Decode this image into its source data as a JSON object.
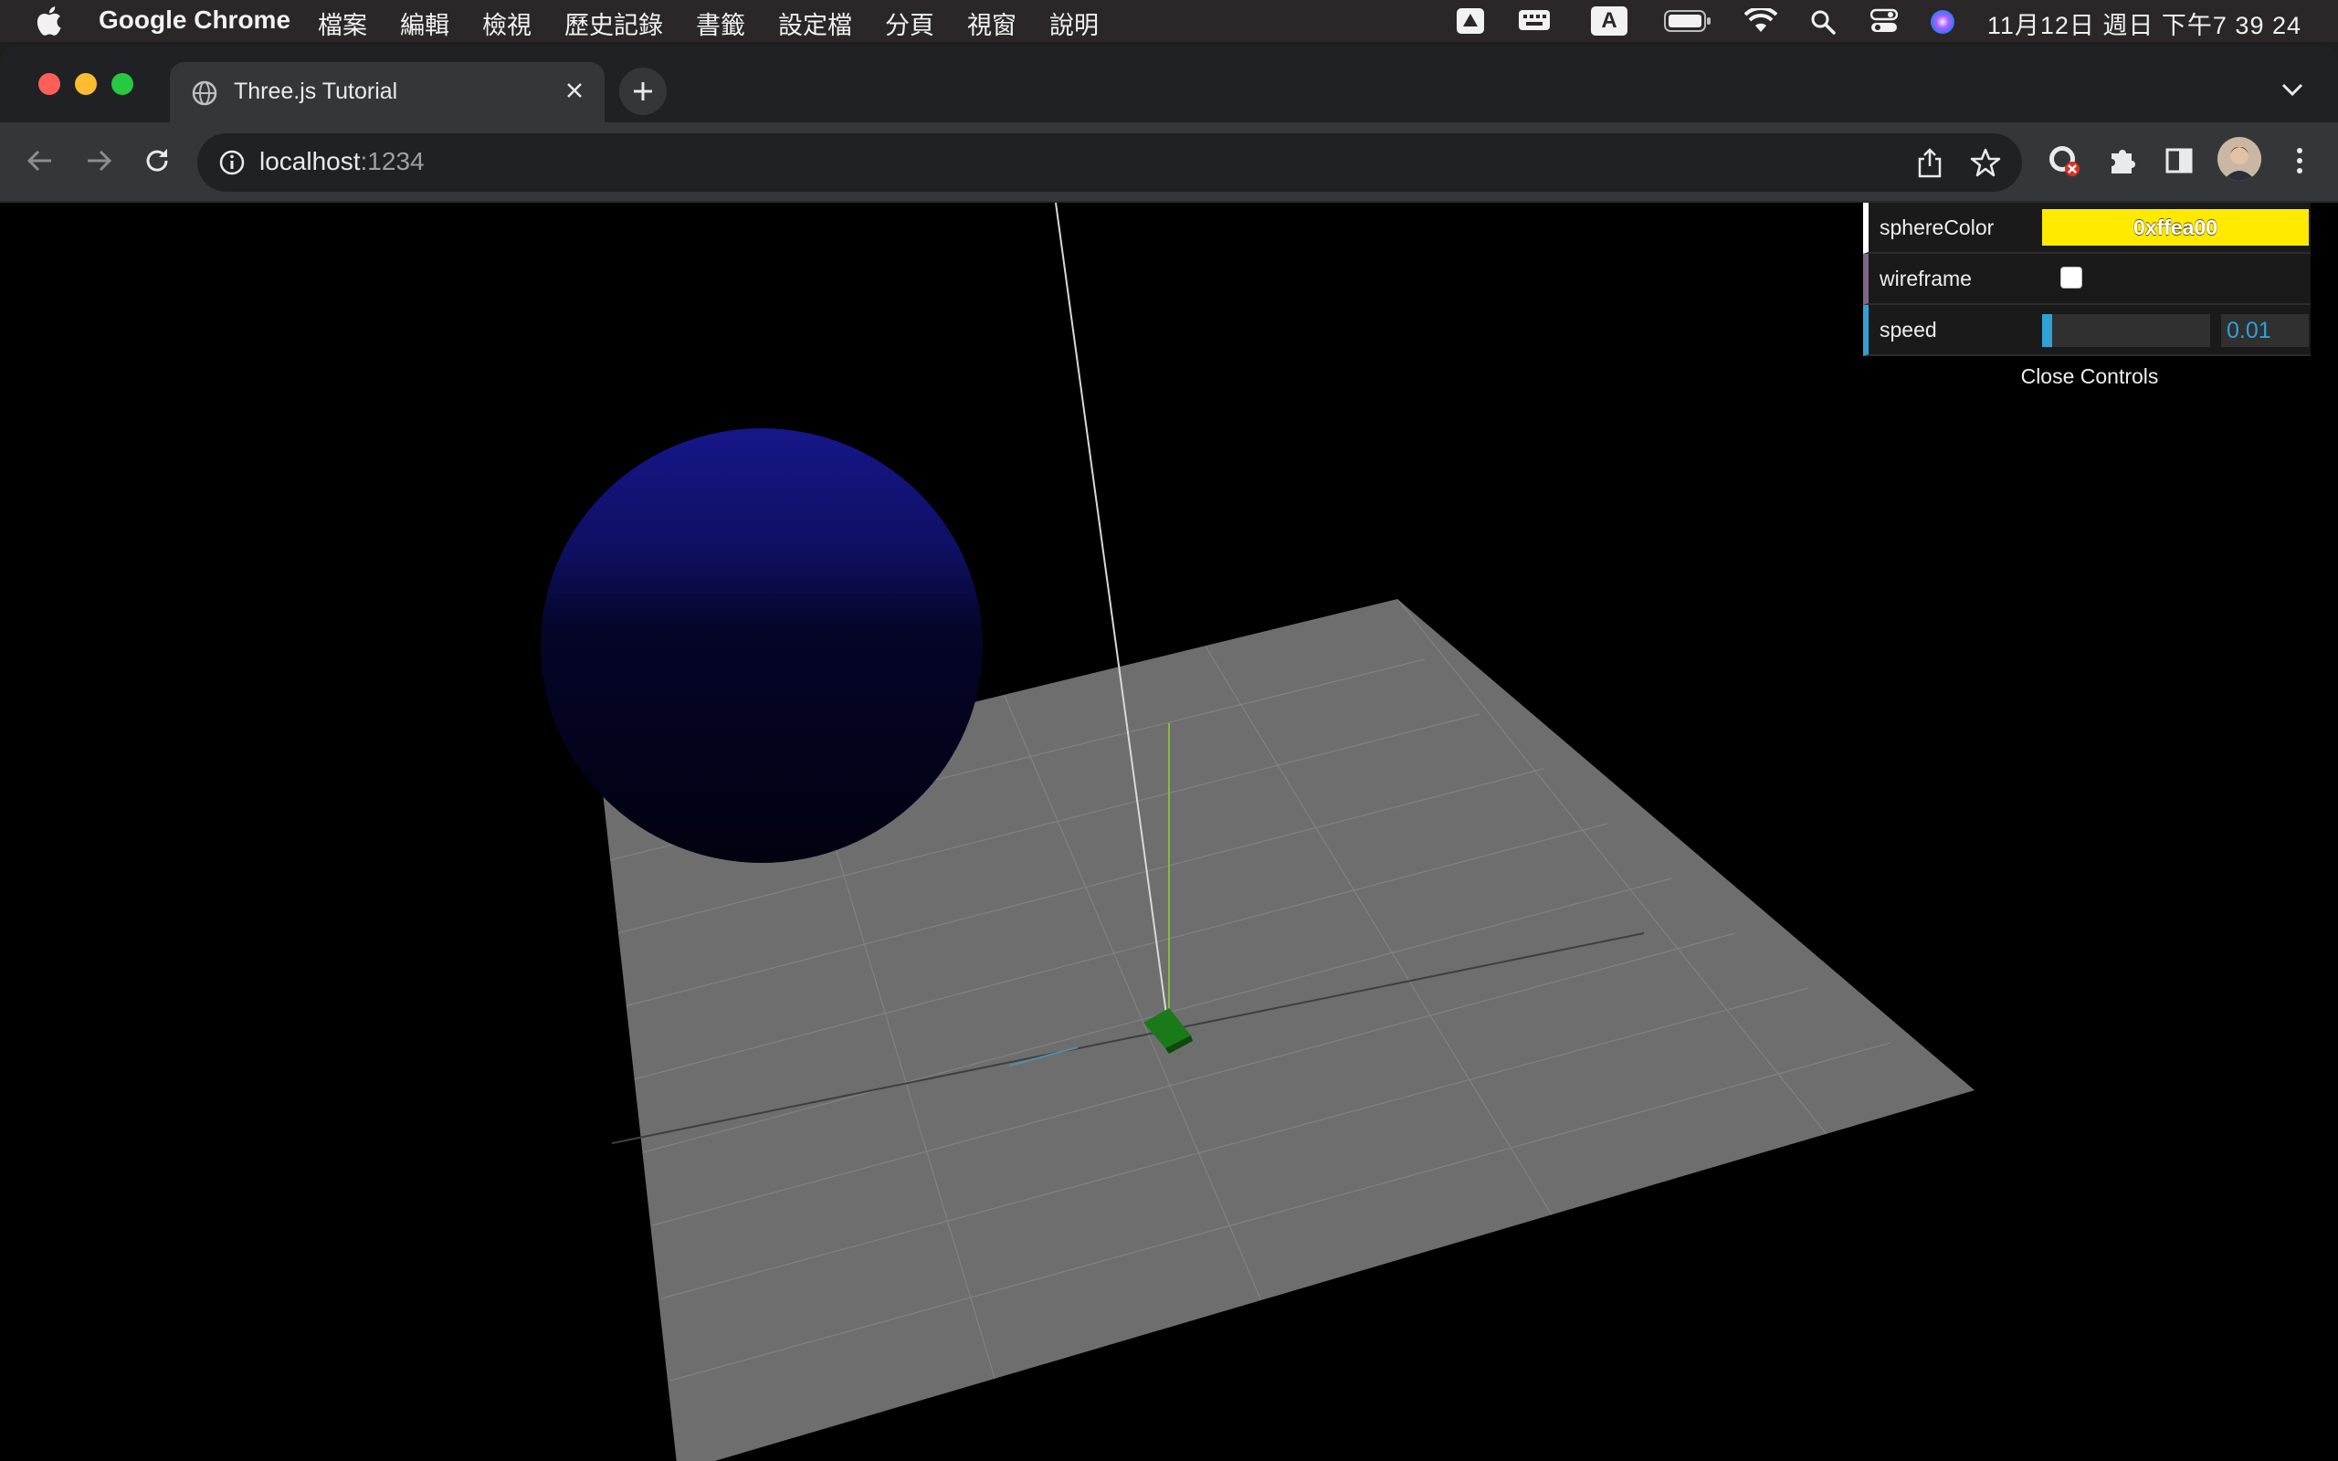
{
  "menubar": {
    "app_name": "Google Chrome",
    "menus": [
      "檔案",
      "編輯",
      "檢視",
      "歷史記錄",
      "書籤",
      "設定檔",
      "分頁",
      "視窗",
      "說明"
    ],
    "status_icons": [
      "drive-icon",
      "keyboard-icon",
      "input-source-icon",
      "battery-icon",
      "wifi-icon",
      "search-icon",
      "control-center-icon",
      "siri-icon"
    ],
    "input_source_label": "A",
    "clock": "11月12日 週日 下午7 39 24"
  },
  "browser": {
    "tab_title": "Three.js Tutorial",
    "url_host": "localhost",
    "url_port": ":1234",
    "traffic_colors": {
      "close": "#ff5f57",
      "minimize": "#febc2e",
      "zoom": "#28c840"
    }
  },
  "scene": {
    "background": "#000000",
    "sphere_color": "#1a1a8a",
    "plane_color": "#6e6e6e",
    "box_color": "#1f7a1f"
  },
  "gui": {
    "sphere_color_label": "sphereColor",
    "sphere_color_value": "0xffea00",
    "wireframe_label": "wireframe",
    "wireframe_checked": false,
    "speed_label": "speed",
    "speed_value": "0.01",
    "speed_fraction": 0.06,
    "close_label": "Close Controls"
  }
}
